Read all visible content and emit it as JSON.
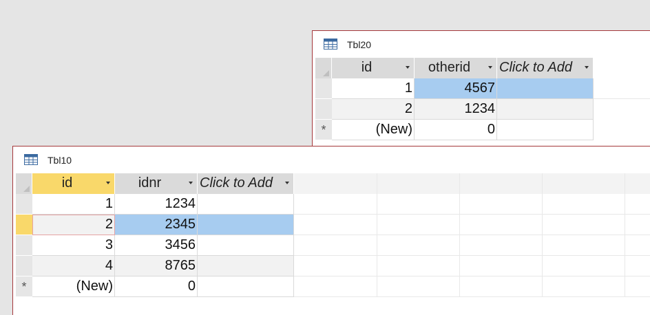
{
  "tbl20": {
    "title": "Tbl20",
    "columns": [
      "id",
      "otherid",
      "Click to Add"
    ],
    "rows": [
      [
        "1",
        "4567",
        ""
      ],
      [
        "2",
        "1234",
        ""
      ],
      [
        "(New)",
        "0",
        ""
      ]
    ],
    "new_row_marker": "*"
  },
  "tbl10": {
    "title": "Tbl10",
    "columns": [
      "id",
      "idnr",
      "Click to Add"
    ],
    "rows": [
      [
        "1",
        "1234",
        ""
      ],
      [
        "2",
        "2345",
        ""
      ],
      [
        "3",
        "3456",
        ""
      ],
      [
        "4",
        "8765",
        ""
      ],
      [
        "(New)",
        "0",
        ""
      ]
    ],
    "new_row_marker": "*"
  },
  "colors": {
    "window_border": "#a4373a",
    "selection": "#a7ccf0",
    "current_row": "#f9d86a",
    "header": "#dadada"
  },
  "icons": {
    "table": "table-icon",
    "dropdown": "chevron-down-icon"
  }
}
